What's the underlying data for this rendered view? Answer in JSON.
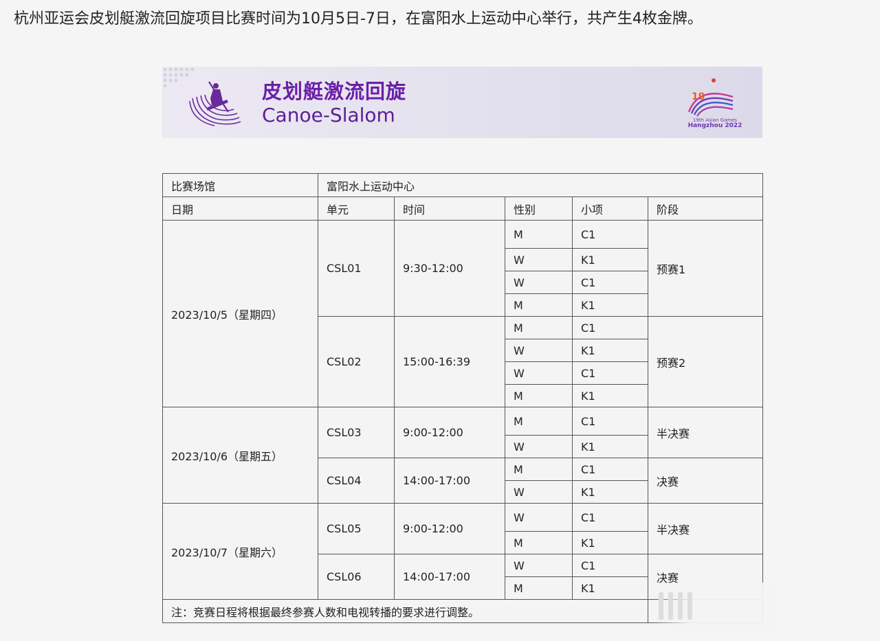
{
  "intro_text": "杭州亚运会皮划艇激流回旋项目比赛时间为10月5日-7日，在富阳水上运动中心举行，共产生4枚金牌。",
  "banner": {
    "title_zh": "皮划艇激流回旋",
    "title_en": "Canoe-Slalom",
    "logo_line1": "19th Asian Games",
    "logo_line2": "Hangzhou 2022",
    "accent_color": "#6b1fa8"
  },
  "table": {
    "venue_label": "比赛场馆",
    "venue_value": "富阳水上运动中心",
    "headers": [
      "日期",
      "单元",
      "时间",
      "性别",
      "小项",
      "阶段"
    ],
    "days": [
      {
        "date": "2023/10/5（星期四）",
        "units": [
          {
            "unit": "CSL01",
            "time": "9:30-12:00",
            "stage": "预赛1",
            "events": [
              {
                "gender": "M",
                "event": "C1"
              },
              {
                "gender": "W",
                "event": "K1"
              },
              {
                "gender": "W",
                "event": "C1"
              },
              {
                "gender": "M",
                "event": "K1"
              }
            ]
          },
          {
            "unit": "CSL02",
            "time": "15:00-16:39",
            "stage": "预赛2",
            "events": [
              {
                "gender": "M",
                "event": "C1"
              },
              {
                "gender": "W",
                "event": "K1"
              },
              {
                "gender": "W",
                "event": "C1"
              },
              {
                "gender": "M",
                "event": "K1"
              }
            ]
          }
        ]
      },
      {
        "date": "2023/10/6（星期五）",
        "units": [
          {
            "unit": "CSL03",
            "time": "9:00-12:00",
            "stage": "半决赛",
            "events": [
              {
                "gender": "M",
                "event": "C1"
              },
              {
                "gender": "W",
                "event": "K1"
              }
            ]
          },
          {
            "unit": "CSL04",
            "time": "14:00-17:00",
            "stage": "决赛",
            "events": [
              {
                "gender": "M",
                "event": "C1"
              },
              {
                "gender": "W",
                "event": "K1"
              }
            ]
          }
        ]
      },
      {
        "date": "2023/10/7（星期六）",
        "units": [
          {
            "unit": "CSL05",
            "time": "9:00-12:00",
            "stage": "半决赛",
            "events": [
              {
                "gender": "W",
                "event": "C1"
              },
              {
                "gender": "M",
                "event": "K1"
              }
            ]
          },
          {
            "unit": "CSL06",
            "time": "14:00-17:00",
            "stage": "决赛",
            "events": [
              {
                "gender": "W",
                "event": "C1"
              },
              {
                "gender": "M",
                "event": "K1"
              }
            ]
          }
        ]
      }
    ],
    "note": "注：竞赛日程将根据最终参赛人数和电视转播的要求进行调整。"
  }
}
